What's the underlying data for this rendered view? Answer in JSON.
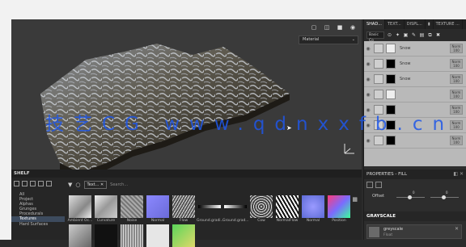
{
  "viewport": {
    "material_select": "Material",
    "tool_icons": [
      "camera-icon",
      "display-icon",
      "screenshot-icon",
      "snapshot-icon"
    ]
  },
  "right_panel": {
    "tabs": [
      "SHAD...",
      "TEXT...",
      "DISPL...",
      "",
      "TEXTURE ..."
    ],
    "blend_select": "Basic Co",
    "layers": [
      {
        "name": "Snow",
        "mode": "Norm",
        "value": "100"
      },
      {
        "name": "Snow",
        "mode": "Norm",
        "value": "100"
      },
      {
        "name": "Snow",
        "mode": "Norm",
        "value": "100"
      },
      {
        "name": "",
        "mode": "Norm",
        "value": "100"
      },
      {
        "name": "",
        "mode": "Norm",
        "value": "100"
      },
      {
        "name": "",
        "mode": "Norm",
        "value": "100"
      },
      {
        "name": "",
        "mode": "Norm",
        "value": "100"
      }
    ],
    "properties_title": "PROPERTIES - FILL",
    "offset_label": "Offset",
    "offset_values": [
      "0",
      "0"
    ],
    "grayscale_title": "GRAYSCALE",
    "grayscale_item": {
      "name": "greyscale",
      "mode": "Float"
    }
  },
  "shelf": {
    "title": "SHELF",
    "categories": [
      "All",
      "Project",
      "Alphas",
      "Grunges",
      "Procedurals",
      "Textures",
      "Hard Surfaces"
    ],
    "selected_category": "Textures",
    "filter_chip": "Text...",
    "search_placeholder": "Search...",
    "tiles": [
      {
        "label": "Ambient Oc..."
      },
      {
        "label": "Curvature"
      },
      {
        "label": "Noise"
      },
      {
        "label": "Normal"
      },
      {
        "label": "Flow"
      },
      {
        "label": "Ground.gradi..."
      },
      {
        "label": "Ground.grad..."
      },
      {
        "label": "Cow"
      },
      {
        "label": "NormalFlow"
      },
      {
        "label": "Normal"
      },
      {
        "label": "Position"
      }
    ]
  },
  "watermark": "技艺CG www.qdnxxfb.cn"
}
